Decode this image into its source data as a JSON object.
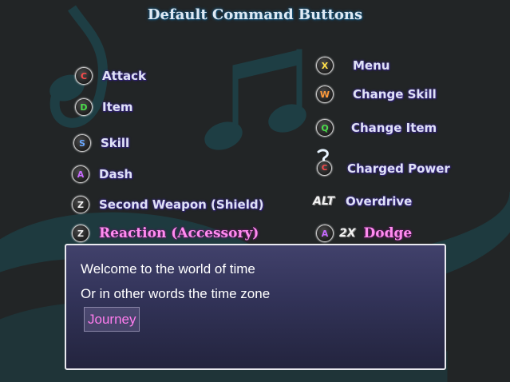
{
  "title": "Default Command Buttons",
  "left_commands": [
    {
      "key": "C",
      "key_color": "#ff4a4a",
      "label": "Attack"
    },
    {
      "key": "D",
      "key_color": "#4ade4a",
      "label": "Item"
    },
    {
      "key": "S",
      "key_color": "#6aa8ff",
      "label": "Skill"
    },
    {
      "key": "A",
      "key_color": "#c86aff",
      "label": "Dash"
    },
    {
      "key": "Z",
      "key_color": "#f0f0f0",
      "label": "Second Weapon  (Shield)"
    },
    {
      "key": "Z",
      "key_color": "#f0f0f0",
      "label": "Reaction (Accessory)"
    }
  ],
  "right_commands": [
    {
      "key": "X",
      "key_color": "#ffe04a",
      "label": "Menu"
    },
    {
      "key": "W",
      "key_color": "#ff9a3a",
      "label": "Change Skill"
    },
    {
      "key": "Q",
      "key_color": "#4ade4a",
      "label": "Change Item"
    },
    {
      "key": "C",
      "key_color": "#ff4a4a",
      "label": "Charged Power",
      "note": "hold"
    },
    {
      "key": "ALT",
      "label": "Overdrive"
    },
    {
      "key": "A",
      "key_color": "#c86aff",
      "multiplier": "2X",
      "label": "Dodge"
    }
  ],
  "dialog": {
    "line1": "Welcome to the world of time",
    "line2": "Or in other words the time zone",
    "choice": "Journey"
  },
  "colors": {
    "background": "#222526",
    "notes": "#1e3e44",
    "dialog_top": "#41416b",
    "dialog_bottom": "#23243e",
    "highlight_label": "#ff8cf0"
  },
  "icons": [
    "music-note-background",
    "button-glyph",
    "hold-swoosh-icon"
  ]
}
